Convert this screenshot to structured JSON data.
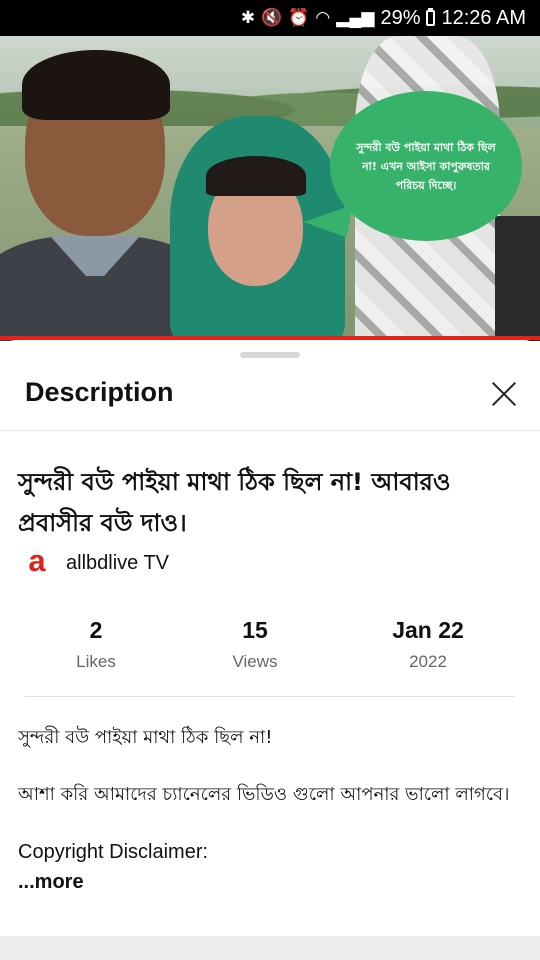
{
  "status_bar": {
    "battery": "29%",
    "time": "12:26 AM"
  },
  "thumbnail": {
    "overlay_text": "সুন্দরী বউ পাইয়া মাথা ঠিক ছিল না! এখন আইসা কাপুরুষতার পরিচয় দিচ্ছে।"
  },
  "sheet": {
    "header_title": "Description",
    "video_title": "সুন্দরী বউ পাইয়া মাথা ঠিক ছিল না! আবারও প্রবাসীর বউ দাও।",
    "channel": {
      "logo_letter": "a",
      "name": "allbdlive TV"
    },
    "stats": {
      "likes_value": "2",
      "likes_label": "Likes",
      "views_value": "15",
      "views_label": "Views",
      "date_value": "Jan 22",
      "date_year": "2022"
    },
    "description": {
      "line1": "সুন্দরী বউ পাইয়া মাথা ঠিক ছিল না!",
      "line2": "আশা করি আমাদের চ্যানেলের ভিডিও গুলো আপনার ভালো লাগবে।",
      "line3": "Copyright Disclaimer:",
      "more": "...more"
    }
  },
  "colors": {
    "accent_red": "#e62117",
    "bubble_green": "#37b26a"
  }
}
